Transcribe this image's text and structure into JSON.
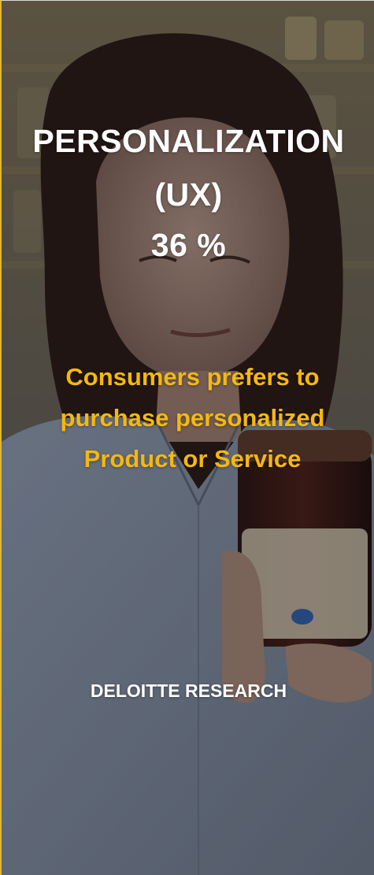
{
  "headline": {
    "line1": "PERSONALIZATION",
    "line2": "(UX)",
    "stat": "36 %"
  },
  "tagline": {
    "line1": "Consumers prefers to",
    "line2": "purchase personalized",
    "line3": "Product or Service"
  },
  "source": "DELOITTE RESEARCH",
  "colors": {
    "headline": "#ffffff",
    "tagline": "#f5b80f",
    "border_accent": "#e0b830"
  }
}
